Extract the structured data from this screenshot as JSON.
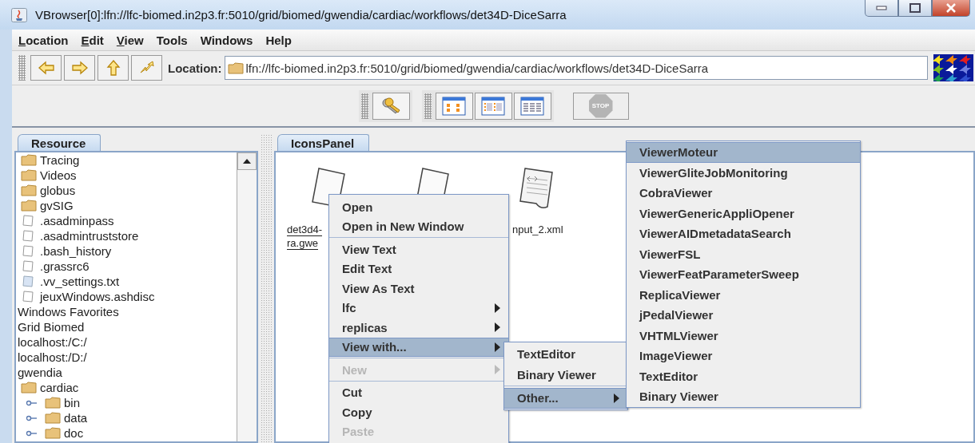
{
  "window": {
    "title": "VBrowser[0]:lfn://lfc-biomed.in2p3.fr:5010/grid/biomed/gwendia/cardiac/workflows/det34D-DiceSarra"
  },
  "menubar": [
    {
      "label": "Location",
      "mnemonic": true
    },
    {
      "label": "Edit",
      "mnemonic": true
    },
    {
      "label": "View",
      "mnemonic": true
    },
    {
      "label": "Tools",
      "mnemonic": false
    },
    {
      "label": "Windows",
      "mnemonic": false
    },
    {
      "label": "Help",
      "mnemonic": false
    }
  ],
  "toolbar": {
    "buttons": [
      {
        "kind": "back"
      },
      {
        "kind": "forward"
      },
      {
        "kind": "up"
      },
      {
        "kind": "refresh"
      }
    ],
    "location_label": "Location:",
    "location": "lfn://lfc-biomed.in2p3.fr:5010/grid/biomed/gwendia/cardiac/workflows/det34D-DiceSarra"
  },
  "view_toolbar": {
    "groups": [
      [
        {
          "kind": "key"
        }
      ],
      [
        {
          "kind": "icons"
        },
        {
          "kind": "list"
        },
        {
          "kind": "details"
        }
      ]
    ],
    "stop": {
      "label": "STOP",
      "disabled": true
    }
  },
  "resource_panel": {
    "tab": "Resource",
    "tree": [
      {
        "label": "Tracing",
        "kind": "folder"
      },
      {
        "label": "Videos",
        "kind": "folder"
      },
      {
        "label": "globus",
        "kind": "folder"
      },
      {
        "label": "gvSIG",
        "kind": "folder"
      },
      {
        "label": ".asadminpass",
        "kind": "file"
      },
      {
        "label": ".asadmintruststore",
        "kind": "file"
      },
      {
        "label": ".bash_history",
        "kind": "file"
      },
      {
        "label": ".grassrc6",
        "kind": "file"
      },
      {
        "label": ".vv_settings.txt",
        "kind": "text"
      },
      {
        "label": "jeuxWindows.ashdisc",
        "kind": "file"
      },
      {
        "label": "Windows Favorites",
        "kind": "root"
      },
      {
        "label": "Grid Biomed",
        "kind": "root"
      },
      {
        "label": "localhost:/C:/",
        "kind": "root"
      },
      {
        "label": "localhost:/D:/",
        "kind": "root"
      },
      {
        "label": "gwendia",
        "kind": "root",
        "children": [
          {
            "label": "cardiac",
            "kind": "folder",
            "children": [
              {
                "label": "bin",
                "kind": "folder",
                "expanded": false
              },
              {
                "label": "data",
                "kind": "folder",
                "expanded": false
              },
              {
                "label": "doc",
                "kind": "folder",
                "expanded": false
              }
            ]
          }
        ]
      }
    ]
  },
  "icons_panel": {
    "tab": "IconsPanel",
    "icons": [
      {
        "kind": "file",
        "label_lines": [
          "det3d4-",
          "ra.gwe"
        ],
        "link": true
      },
      {
        "kind": "file"
      },
      {
        "kind": "xml",
        "label_lines": [
          "nput_2.xml"
        ],
        "link": false
      }
    ]
  },
  "context_menu": {
    "items": [
      {
        "kind": "item",
        "label": "Open",
        "selected": false,
        "disabled": false
      },
      {
        "kind": "item",
        "label": "Open in New Window",
        "selected": false,
        "disabled": false
      },
      {
        "kind": "separator"
      },
      {
        "kind": "item",
        "label": "View Text",
        "selected": false,
        "disabled": false
      },
      {
        "kind": "item",
        "label": "Edit Text",
        "selected": false,
        "disabled": false
      },
      {
        "kind": "item",
        "label": "View As Text",
        "selected": false,
        "disabled": false
      },
      {
        "kind": "submenu",
        "label": "lfc",
        "selected": false,
        "disabled": false
      },
      {
        "kind": "submenu",
        "label": "replicas",
        "selected": false,
        "disabled": false
      },
      {
        "kind": "submenu",
        "label": "View with...",
        "selected": true,
        "disabled": false
      },
      {
        "kind": "separator"
      },
      {
        "kind": "submenu",
        "label": "New",
        "selected": false,
        "disabled": true
      },
      {
        "kind": "separator"
      },
      {
        "kind": "item",
        "label": "Cut",
        "selected": false,
        "disabled": false
      },
      {
        "kind": "item",
        "label": "Copy",
        "selected": false,
        "disabled": false
      },
      {
        "kind": "item",
        "label": "Paste",
        "selected": false,
        "disabled": true
      }
    ]
  },
  "submenu": {
    "items": [
      {
        "kind": "item",
        "label": "TextEditor",
        "selected": false,
        "disabled": false
      },
      {
        "kind": "item",
        "label": "Binary Viewer",
        "selected": false,
        "disabled": false
      },
      {
        "kind": "separator"
      },
      {
        "kind": "submenu",
        "label": "Other...",
        "selected": true,
        "disabled": false
      }
    ]
  },
  "submenu_2": {
    "items": [
      {
        "kind": "item",
        "label": "ViewerMoteur",
        "selected": true,
        "disabled": false
      },
      {
        "kind": "item",
        "label": "ViewerGliteJobMonitoring",
        "selected": false,
        "disabled": false
      },
      {
        "kind": "item",
        "label": "CobraViewer",
        "selected": false,
        "disabled": false
      },
      {
        "kind": "item",
        "label": "ViewerGenericAppliOpener",
        "selected": false,
        "disabled": false
      },
      {
        "kind": "item",
        "label": "ViewerAIDmetadataSearch",
        "selected": false,
        "disabled": false
      },
      {
        "kind": "item",
        "label": "ViewerFSL",
        "selected": false,
        "disabled": false
      },
      {
        "kind": "item",
        "label": "ViewerFeatParameterSweep",
        "selected": false,
        "disabled": false
      },
      {
        "kind": "item",
        "label": "ReplicaViewer",
        "selected": false,
        "disabled": false
      },
      {
        "kind": "item",
        "label": "jPedalViewer",
        "selected": false,
        "disabled": false
      },
      {
        "kind": "item",
        "label": "VHTMLViewer",
        "selected": false,
        "disabled": false
      },
      {
        "kind": "item",
        "label": "ImageViewer",
        "selected": false,
        "disabled": false
      },
      {
        "kind": "item",
        "label": "TextEditor",
        "selected": false,
        "disabled": false
      },
      {
        "kind": "item",
        "label": "Binary Viewer",
        "selected": false,
        "disabled": false
      }
    ]
  }
}
